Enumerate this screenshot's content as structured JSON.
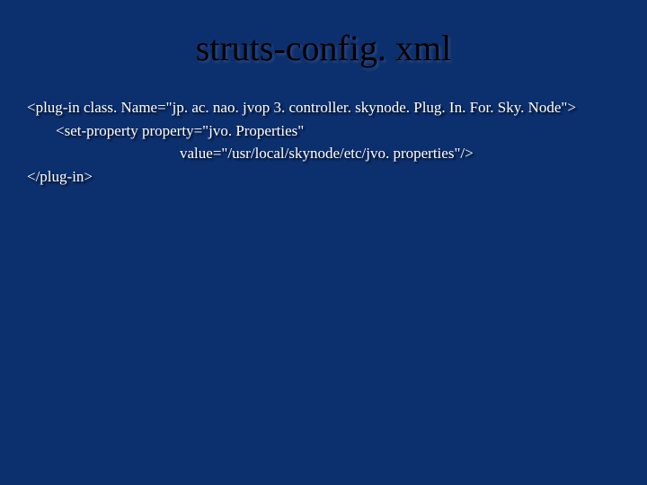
{
  "title": "struts-config. xml",
  "code": {
    "line1": "<plug-in class. Name=\"jp. ac. nao. jvop 3. controller. skynode. Plug. In. For. Sky. Node\">",
    "line2": "<set-property property=\"jvo. Properties\"",
    "line3": "value=\"/usr/local/skynode/etc/jvo. properties\"/>",
    "line4": "</plug-in>"
  }
}
